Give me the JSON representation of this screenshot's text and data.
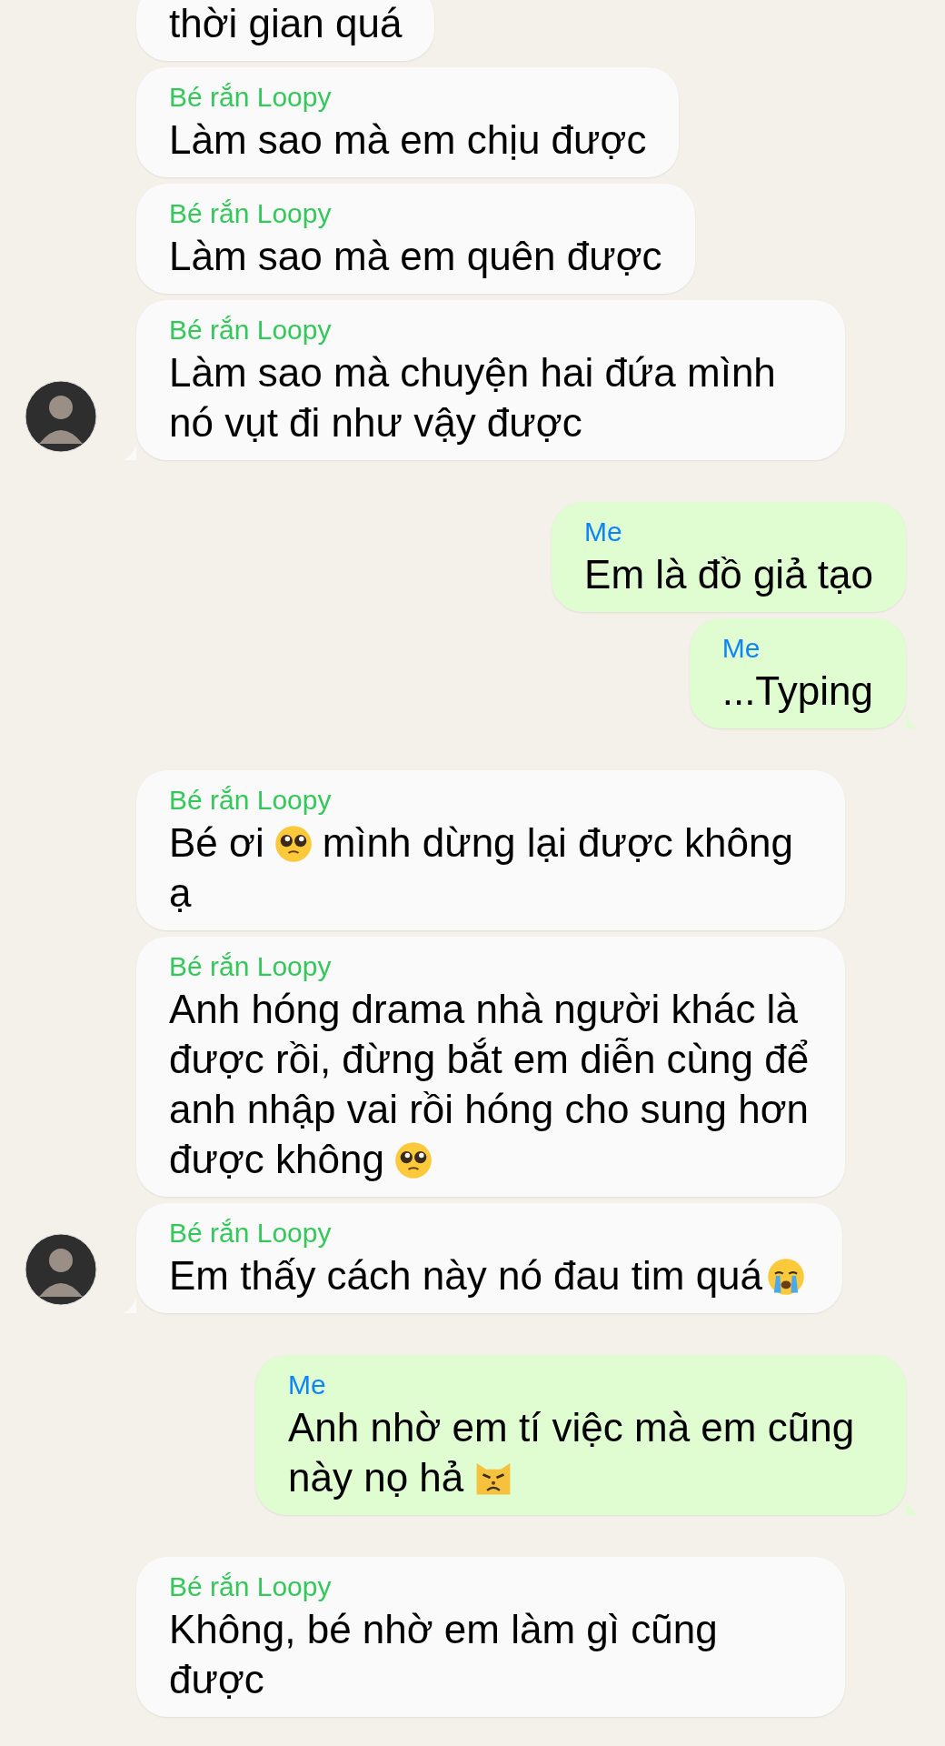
{
  "groups": [
    {
      "kind": "received",
      "messages": [
        {
          "parts": [
            {
              "kind": "text",
              "text": "thời gian quá"
            }
          ]
        },
        {
          "sender": "Bé rắn Loopy",
          "parts": [
            {
              "kind": "text",
              "text": "Làm sao mà em chịu được"
            }
          ]
        },
        {
          "sender": "Bé rắn Loopy",
          "parts": [
            {
              "kind": "text",
              "text": "Làm sao mà em quên được"
            }
          ]
        },
        {
          "sender": "Bé rắn Loopy",
          "tail": true,
          "avatar": true,
          "parts": [
            {
              "kind": "text",
              "text": "Làm sao mà chuyện hai đứa mình nó vụt đi như vậy được"
            }
          ]
        }
      ]
    },
    {
      "kind": "sent",
      "messages": [
        {
          "sender": "Me",
          "parts": [
            {
              "kind": "text",
              "text": "Em là đồ giả tạo"
            }
          ]
        },
        {
          "sender": "Me",
          "tail": true,
          "parts": [
            {
              "kind": "text",
              "text": "...Typing"
            }
          ]
        }
      ]
    },
    {
      "kind": "received",
      "messages": [
        {
          "sender": "Bé rắn Loopy",
          "parts": [
            {
              "kind": "text",
              "text": "Bé ơi"
            },
            {
              "kind": "pleading"
            },
            {
              "kind": "text",
              "text": "mình dừng lại được không ạ"
            }
          ]
        },
        {
          "sender": "Bé rắn Loopy",
          "parts": [
            {
              "kind": "text",
              "text": "Anh hóng drama nhà người khác là được rồi, đừng bắt em diễn cùng để anh nhập vai rồi hóng cho sung hơn được không"
            },
            {
              "kind": "pleading"
            }
          ]
        },
        {
          "sender": "Bé rắn Loopy",
          "tail": true,
          "avatar": true,
          "parts": [
            {
              "kind": "text",
              "text": "Em thấy cách này nó đau tim quá"
            },
            {
              "kind": "crying"
            }
          ]
        }
      ]
    },
    {
      "kind": "sent",
      "messages": [
        {
          "sender": "Me",
          "tail": true,
          "parts": [
            {
              "kind": "text",
              "text": "Anh nhờ em tí việc mà em cũng này nọ hả"
            },
            {
              "kind": "pouting-cat"
            }
          ]
        }
      ]
    },
    {
      "kind": "received",
      "messages": [
        {
          "sender": "Bé rắn Loopy",
          "parts": [
            {
              "kind": "text",
              "text": "Không, bé nhờ em làm gì cũng được"
            }
          ]
        }
      ]
    }
  ]
}
